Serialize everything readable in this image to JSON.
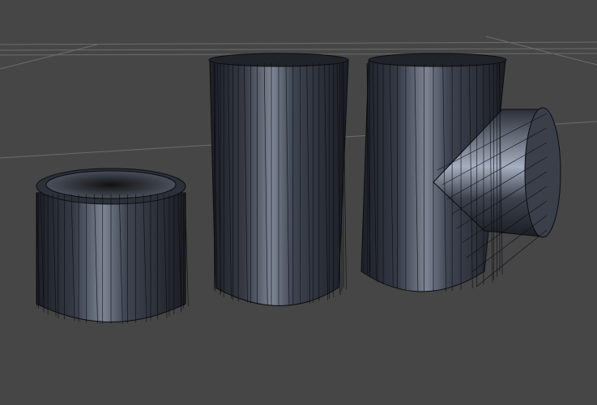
{
  "viewport": {
    "background_color": "#464646",
    "grid_color": "#6a6a6a",
    "mesh_dark": "#1c1f26",
    "mesh_mid": "#3a3f4a",
    "mesh_highlight": "#9aa3b3",
    "wire_color": "#0b0c10"
  },
  "objects": [
    {
      "name": "short-cylinder",
      "wire_segments": 28
    },
    {
      "name": "tall-cylinder",
      "wire_segments": 28
    },
    {
      "name": "tee-pipe",
      "wire_segments": 22
    }
  ]
}
